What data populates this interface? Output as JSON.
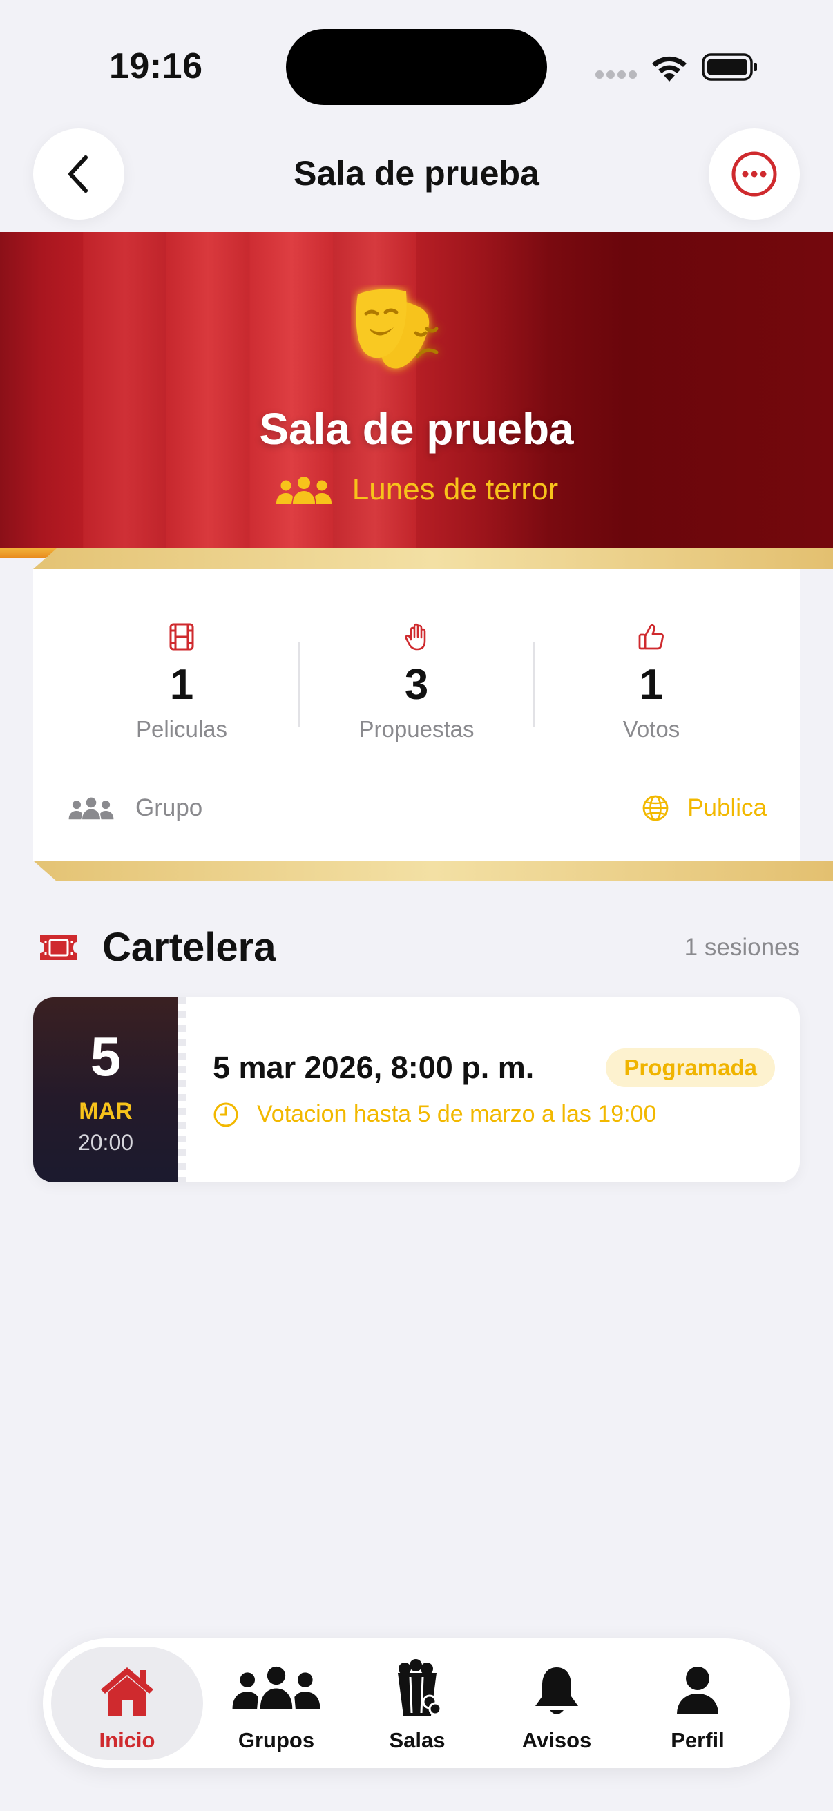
{
  "status_bar": {
    "time": "19:16"
  },
  "header": {
    "title": "Sala de prueba"
  },
  "hero": {
    "title": "Sala de prueba",
    "group_name": "Lunes de terror"
  },
  "stats": [
    {
      "value": "1",
      "label": "Peliculas",
      "icon": "film-icon"
    },
    {
      "value": "3",
      "label": "Propuestas",
      "icon": "hand-raised-icon"
    },
    {
      "value": "1",
      "label": "Votos",
      "icon": "thumbs-up-icon"
    }
  ],
  "meta": {
    "type_label": "Grupo",
    "visibility_label": "Publica"
  },
  "cartelera": {
    "title": "Cartelera",
    "count_label": "1 sesiones",
    "sessions": [
      {
        "day": "5",
        "month": "MAR",
        "time": "20:00",
        "datetime_label": "5 mar 2026, 8:00 p. m.",
        "status": "Programada",
        "deadline_label": "Votacion hasta 5 de marzo a las 19:00"
      }
    ]
  },
  "tab_bar": {
    "tabs": [
      {
        "label": "Inicio",
        "icon": "home-icon",
        "active": true
      },
      {
        "label": "Grupos",
        "icon": "people-icon",
        "active": false
      },
      {
        "label": "Salas",
        "icon": "popcorn-icon",
        "active": false
      },
      {
        "label": "Avisos",
        "icon": "bell-icon",
        "active": false
      },
      {
        "label": "Perfil",
        "icon": "person-icon",
        "active": false
      }
    ]
  },
  "colors": {
    "accent_red": "#cf2a2e",
    "gold": "#f2b800",
    "background": "#f2f2f7"
  }
}
